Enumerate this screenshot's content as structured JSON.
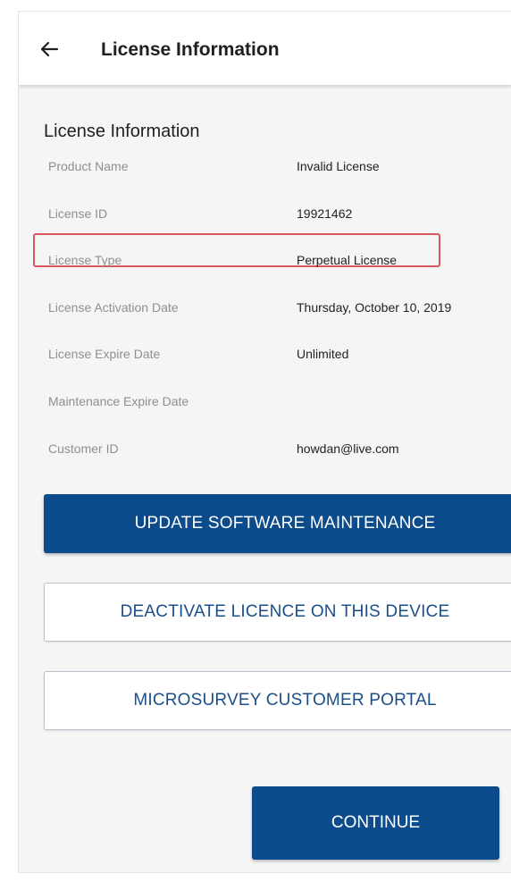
{
  "header": {
    "back_icon": "back-arrow-icon",
    "title": "License Information"
  },
  "section": {
    "title": "License Information"
  },
  "fields": {
    "product_name": {
      "label": "Product Name",
      "value": "Invalid License"
    },
    "license_id": {
      "label": "License ID",
      "value": "19921462"
    },
    "license_type": {
      "label": "License Type",
      "value": "Perpetual License"
    },
    "activation_date": {
      "label": "License Activation Date",
      "value": "Thursday, October 10, 2019"
    },
    "expire_date": {
      "label": "License Expire Date",
      "value": "Unlimited"
    },
    "maintenance_expire_date": {
      "label": "Maintenance Expire Date",
      "value": ""
    },
    "customer_id": {
      "label": "Customer ID",
      "value": "howdan@live.com"
    }
  },
  "buttons": {
    "update_maintenance": "UPDATE SOFTWARE MAINTENANCE",
    "deactivate": "DEACTIVATE LICENCE ON THIS DEVICE",
    "customer_portal": "MICROSURVEY CUSTOMER PORTAL",
    "continue": "CONTINUE"
  },
  "colors": {
    "primary": "#0c4c8d",
    "highlight": "#d9575a",
    "label": "#8f8f8f"
  }
}
